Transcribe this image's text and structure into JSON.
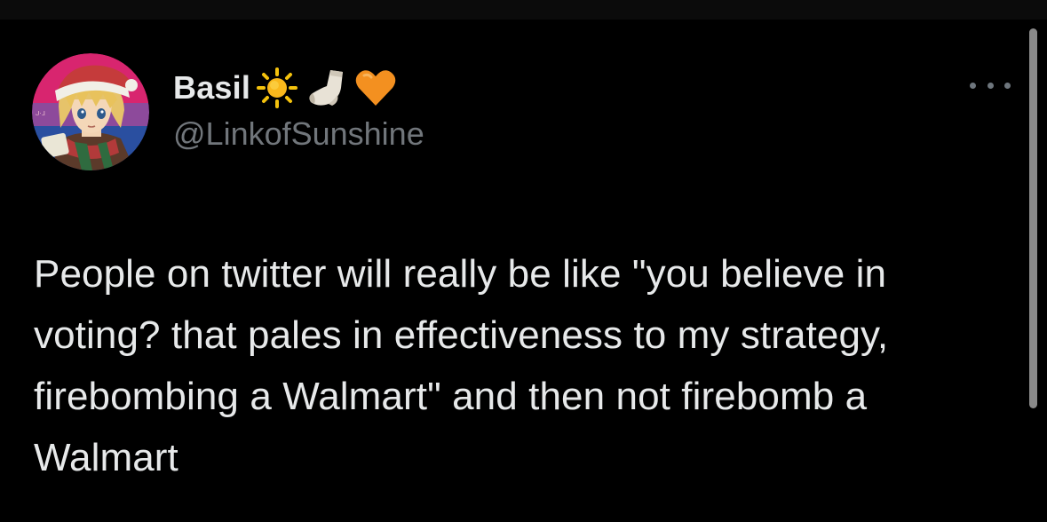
{
  "tweet": {
    "display_name": "Basil",
    "name_emojis": [
      "sun-icon",
      "sock-icon",
      "orange-heart-icon"
    ],
    "handle": "@LinkofSunshine",
    "text": "People on twitter will really be like \"you believe in voting? that pales in effectiveness to my strategy, firebombing a Walmart\" and then not firebomb a Walmart"
  },
  "colors": {
    "background": "#000000",
    "text_primary": "#e7e9ea",
    "text_secondary": "#71767b",
    "sun": "#f4c20d",
    "heart": "#f39020",
    "avatar_flag_pink": "#d8256f",
    "avatar_flag_purple": "#8d4a9b",
    "avatar_flag_blue": "#2a4fa0"
  },
  "icons": {
    "more": "more-options-icon",
    "avatar": "avatar"
  }
}
